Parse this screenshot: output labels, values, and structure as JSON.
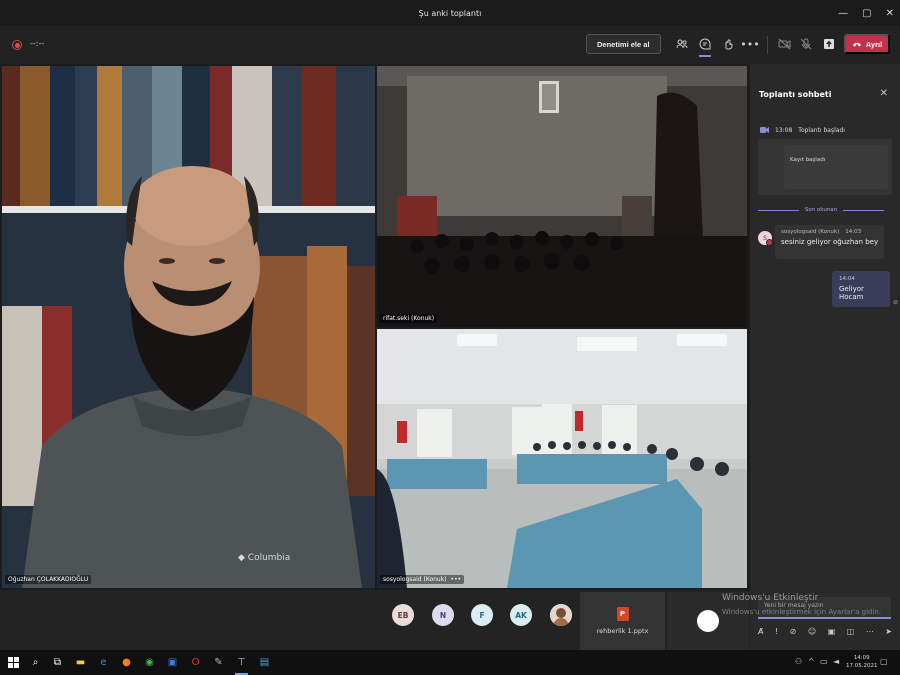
{
  "window": {
    "title": "Şu anki toplantı",
    "controls": [
      "—",
      "▢",
      "✕"
    ]
  },
  "toolbar": {
    "timer": "--:--",
    "take_control_label": "Denetimi ele al",
    "leave_label": "Ayrıl",
    "more_label": "•••",
    "leave_color": "#c4314b"
  },
  "participants": {
    "main_name": "Oğuzhan ÇOLAKKADIOĞLU",
    "top_right_name": "rifat.seki (Konuk)",
    "bottom_right_name": "sosyologsaid (Konuk)",
    "bottom_right_more": "•••",
    "avatars": [
      {
        "initials": "EB",
        "bg": "#e8ddd7",
        "fg": "#5a4036"
      },
      {
        "initials": "N",
        "bg": "#dcdcf0",
        "fg": "#3d3f86"
      },
      {
        "initials": "F",
        "bg": "#d9eef2",
        "fg": "#256a7a"
      },
      {
        "initials": "AK",
        "bg": "#d9eef2",
        "fg": "#256a7a"
      }
    ],
    "shared_file": "rehberlik 1.pptx"
  },
  "chat": {
    "title": "Toplantı sohbeti",
    "system_time": "13:08",
    "system_text": "Toplantı başladı",
    "system_card_text": "Kayıt başladı",
    "last_read_label": "Son okunan",
    "incoming": {
      "initial": "S",
      "sender": "sosyologsaid (Konuk)",
      "time": "14:03",
      "text": "sesiniz geliyor oğuzhan bey"
    },
    "outgoing": {
      "time": "14:04",
      "text": "Geliyor Hocam"
    },
    "input_placeholder": "Yeni bir mesaj yazın",
    "activate_title": "Windows'u Etkinleştir",
    "activate_sub": "Windows'u etkinleştirmek için Ayarlar'a gidin."
  },
  "taskbar": {
    "time": "14:09",
    "date": "17.05.2021"
  },
  "colors": {
    "accent": "#8a8cd8",
    "background": "#1f1f1f",
    "chat_bg": "#292929"
  }
}
